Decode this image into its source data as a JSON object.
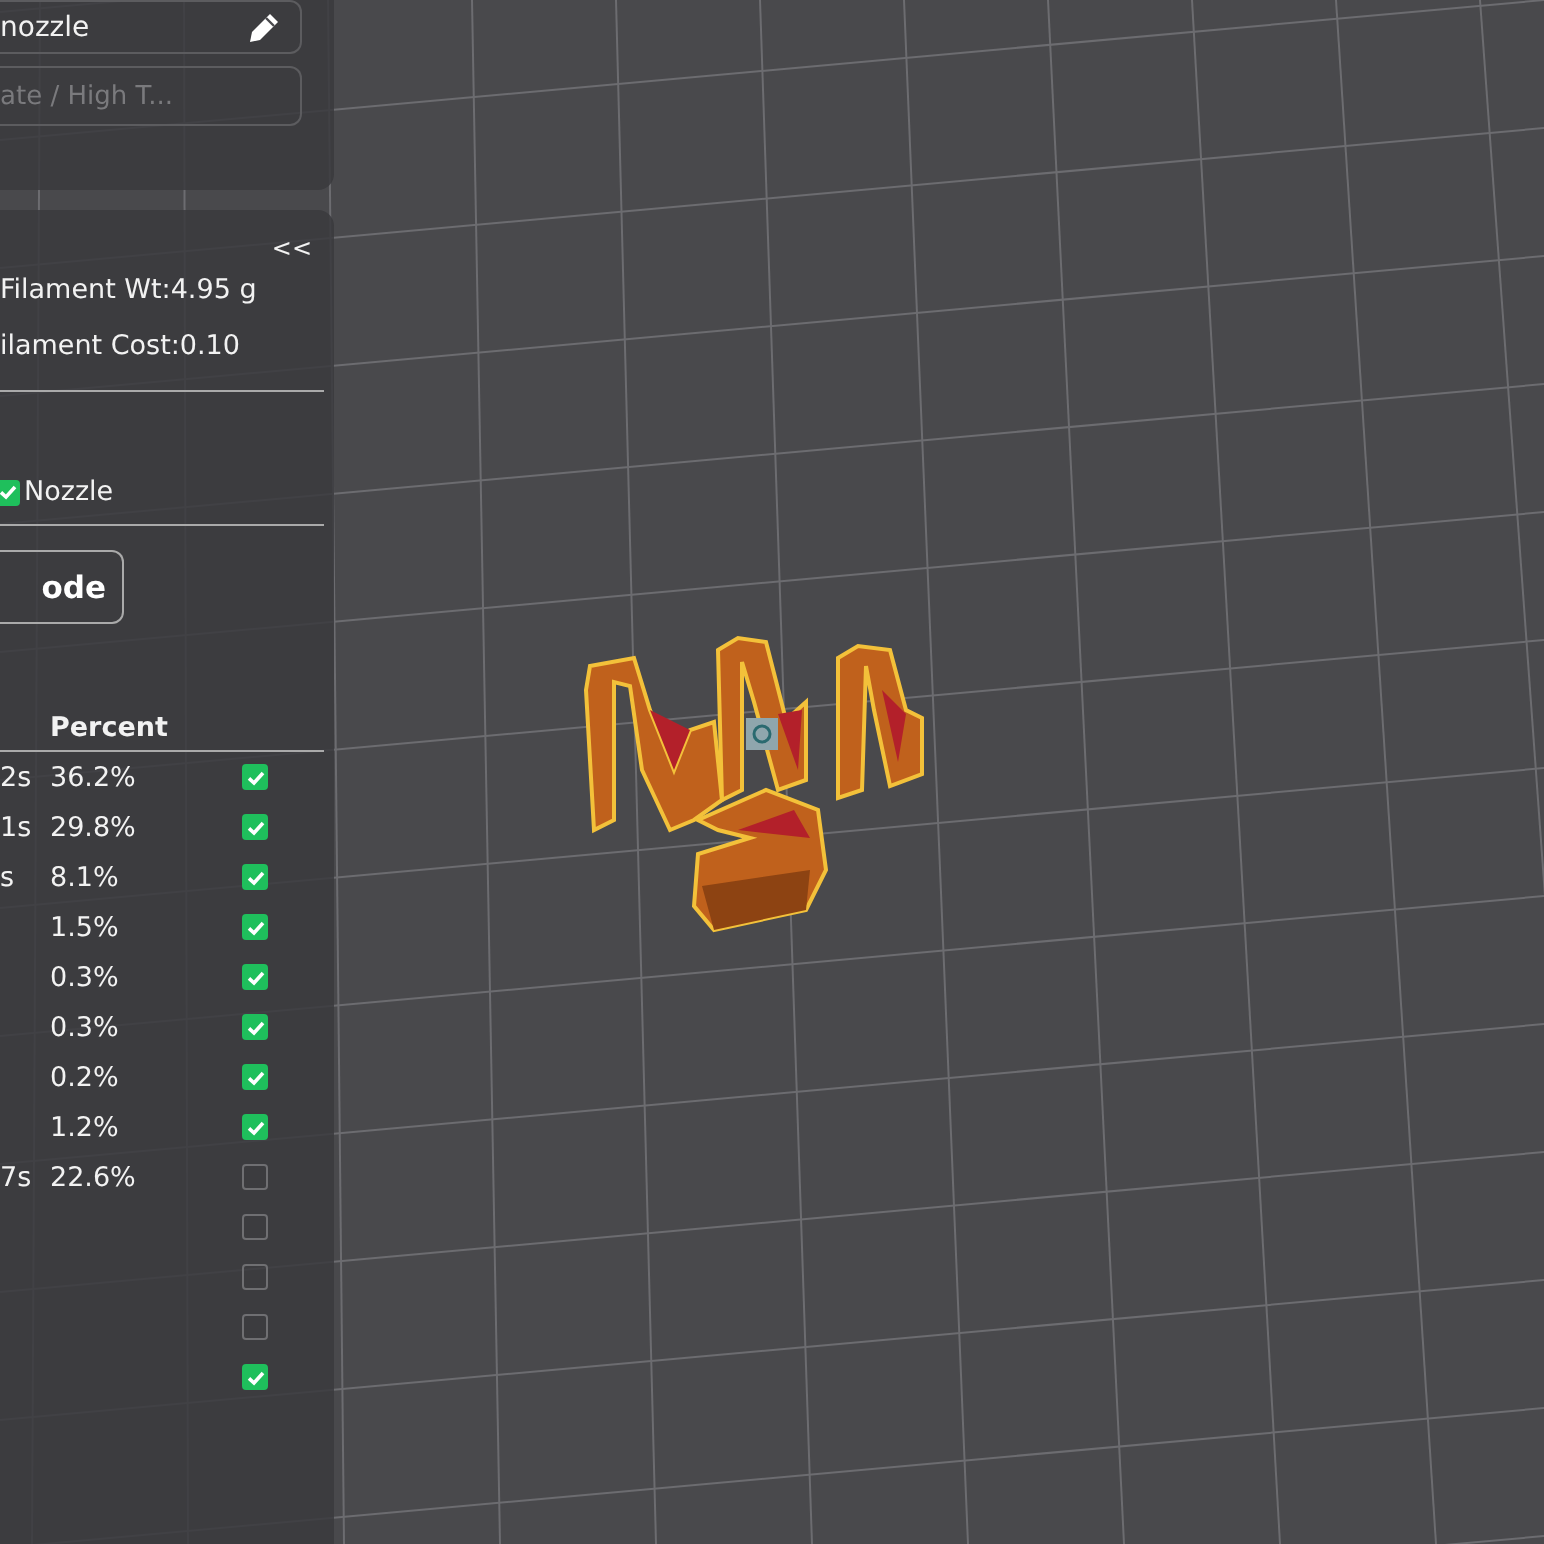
{
  "profile": {
    "nozzle_label": "nozzle",
    "preset_placeholder": "ate / High T..."
  },
  "summary": {
    "collapse": "<<",
    "filament_weight": "Filament Wt:4.95 g",
    "filament_cost": "ilament Cost:0.10"
  },
  "options": [
    {
      "label": "Nozzle",
      "checked": true
    }
  ],
  "export_button": "ode",
  "table": {
    "columns": [
      "Percent"
    ],
    "rows": [
      {
        "time": "2s",
        "percent": "36.2%",
        "checked": true
      },
      {
        "time": "1s",
        "percent": "29.8%",
        "checked": true
      },
      {
        "time": "s",
        "percent": "8.1%",
        "checked": true
      },
      {
        "percent": "1.5%",
        "checked": true
      },
      {
        "percent": "0.3%",
        "checked": true
      },
      {
        "percent": "0.3%",
        "checked": true
      },
      {
        "percent": "0.2%",
        "checked": true
      },
      {
        "percent": "1.2%",
        "checked": true
      },
      {
        "time": "7s",
        "percent": "22.6%",
        "checked": false
      },
      {
        "checked": false
      },
      {
        "checked": false
      },
      {
        "checked": false
      },
      {
        "checked": true
      }
    ]
  }
}
